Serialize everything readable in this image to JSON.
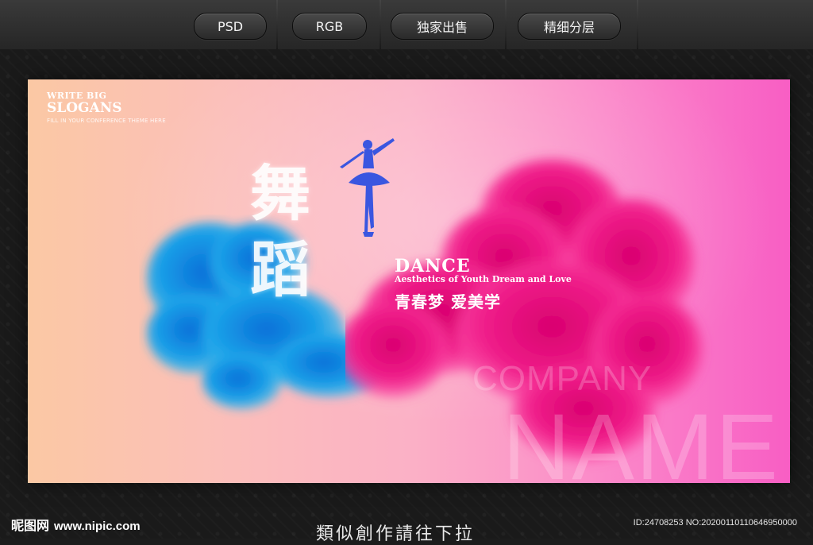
{
  "toolbar": {
    "badges": [
      {
        "label": "PSD"
      },
      {
        "label": "RGB"
      },
      {
        "label": "独家出售"
      },
      {
        "label": "精细分层"
      }
    ]
  },
  "poster": {
    "slogan_top": "WRITE BIG",
    "slogan_main": "SLOGANS",
    "slogan_sub": "FILL IN YOUR CONFERENCE THEME HERE",
    "calligraphy": "舞蹈",
    "dance_title": "DANCE",
    "dance_sub": "Aesthetics of Youth Dream and Love",
    "cn_tagline": "青春梦  爱美学",
    "company": "COMPANY",
    "name": "NAME",
    "colors": {
      "ink_blue": "#1aa0e8",
      "ink_magenta": "#f01e8a",
      "bg_left": "#fbc8a4",
      "bg_right": "#f85ec4"
    }
  },
  "footer": {
    "logo": "昵图网",
    "site": "www.nipic.com",
    "center_text": "類似創作請往下拉",
    "id_text": "ID:24708253 NO:20200110110646950000"
  }
}
